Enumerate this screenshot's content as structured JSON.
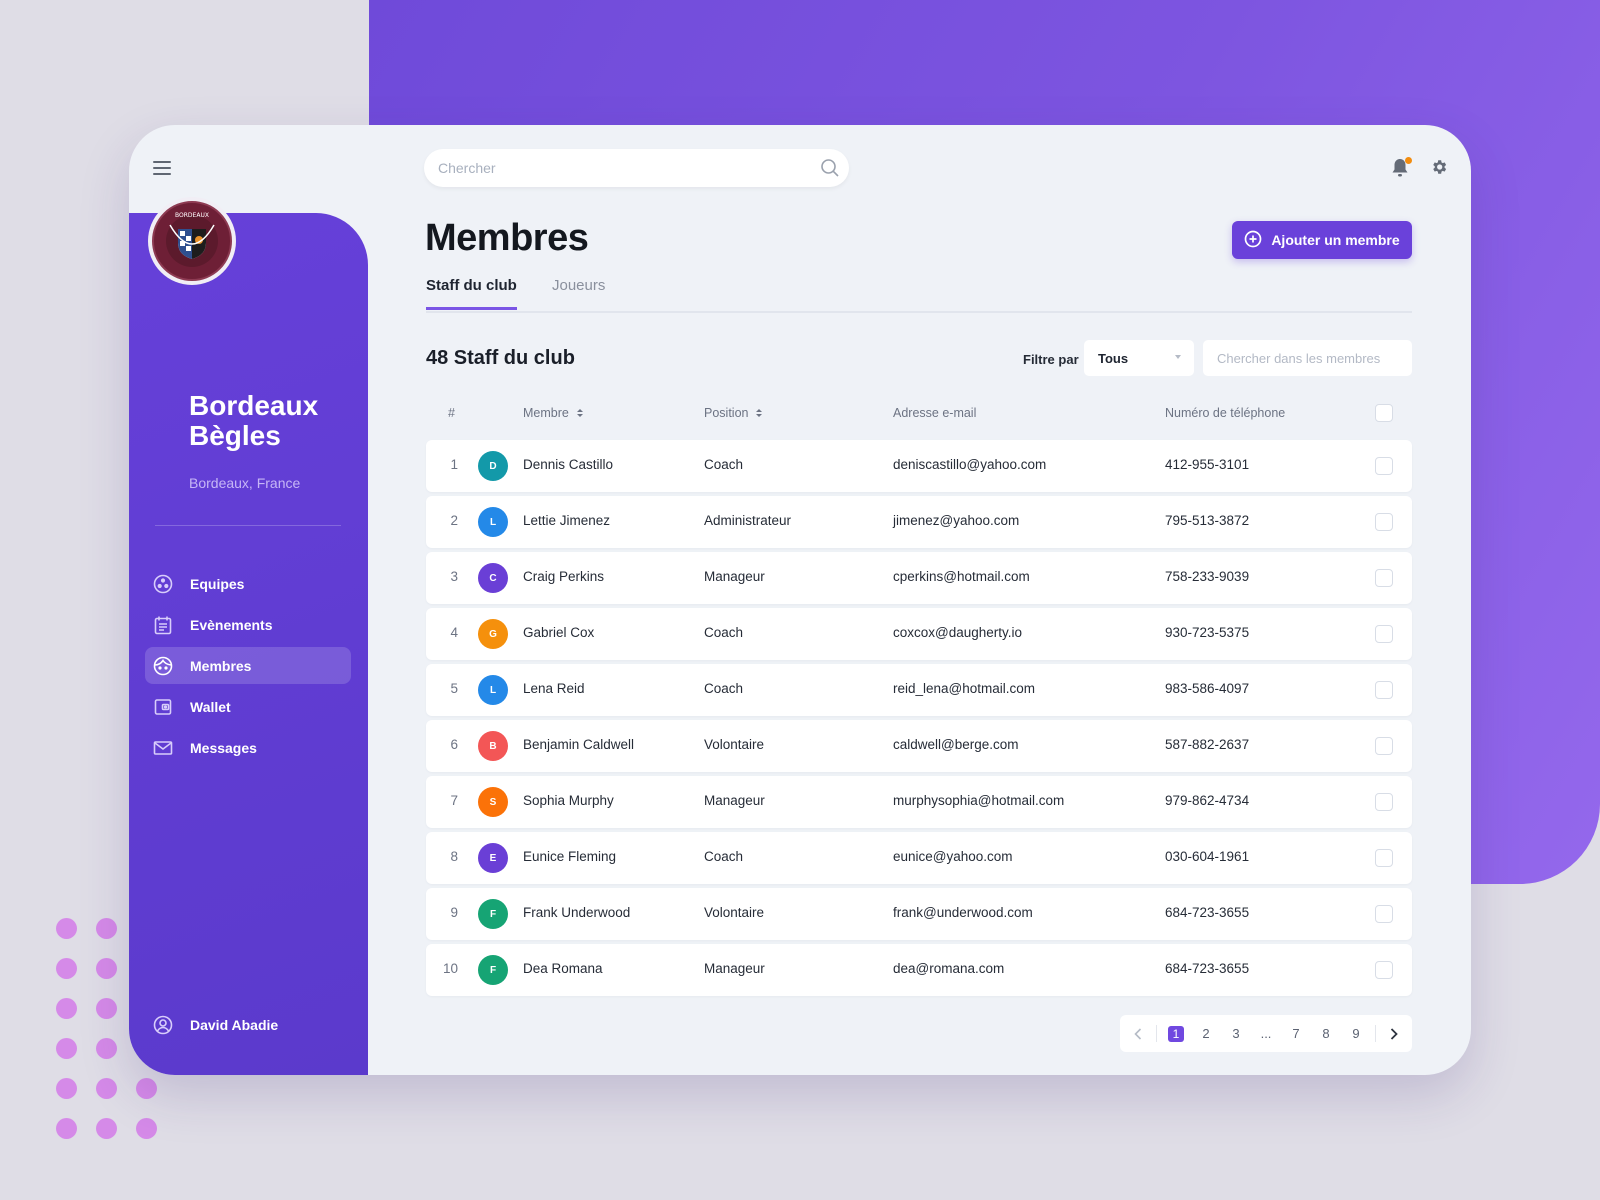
{
  "app": {
    "club_name": "Bordeaux Bègles",
    "club_location": "Bordeaux, France",
    "accent_color": "#6a41da",
    "notification_dot_color": "#f28c0f"
  },
  "topbar": {
    "search_placeholder": "Chercher",
    "icons": [
      "menu-icon",
      "search-icon",
      "bell-icon",
      "gear-icon"
    ]
  },
  "sidebar": {
    "items": [
      {
        "label": "Equipes",
        "icon": "teams-icon",
        "active": false
      },
      {
        "label": "Evènements",
        "icon": "calendar-icon",
        "active": false
      },
      {
        "label": "Membres",
        "icon": "face-icon",
        "active": true
      },
      {
        "label": "Wallet",
        "icon": "wallet-icon",
        "active": false
      },
      {
        "label": "Messages",
        "icon": "mail-icon",
        "active": false
      }
    ],
    "user": {
      "name": "David Abadie",
      "icon": "user-circle-icon"
    }
  },
  "main": {
    "title": "Membres",
    "add_button": "Ajouter un membre",
    "tabs": [
      {
        "label": "Staff du club",
        "active": true
      },
      {
        "label": "Joueurs",
        "active": false
      }
    ],
    "count_title": "48 Staff du club",
    "filter_label": "Filtre par",
    "filter_value": "Tous",
    "member_search_placeholder": "Chercher dans les membres",
    "columns": [
      "#",
      "Membre",
      "Position",
      "Adresse e-mail",
      "Numéro de téléphone"
    ],
    "rows": [
      {
        "idx": "1",
        "initial": "D",
        "color": "#1399a9",
        "name": "Dennis Castillo",
        "position": "Coach",
        "email": "deniscastillo@yahoo.com",
        "phone": "412-955-3101"
      },
      {
        "idx": "2",
        "initial": "L",
        "color": "#2489e8",
        "name": "Lettie Jimenez",
        "position": "Administrateur",
        "email": "jimenez@yahoo.com",
        "phone": "795-513-3872"
      },
      {
        "idx": "3",
        "initial": "C",
        "color": "#6a3fd6",
        "name": "Craig Perkins",
        "position": "Manageur",
        "email": "cperkins@hotmail.com",
        "phone": "758-233-9039"
      },
      {
        "idx": "4",
        "initial": "G",
        "color": "#f5900c",
        "name": "Gabriel Cox",
        "position": "Coach",
        "email": "coxcox@daugherty.io",
        "phone": "930-723-5375"
      },
      {
        "idx": "5",
        "initial": "L",
        "color": "#2489e8",
        "name": "Lena Reid",
        "position": "Coach",
        "email": "reid_lena@hotmail.com",
        "phone": "983-586-4097"
      },
      {
        "idx": "6",
        "initial": "B",
        "color": "#f35656",
        "name": "Benjamin Caldwell",
        "position": "Volontaire",
        "email": "caldwell@berge.com",
        "phone": "587-882-2637"
      },
      {
        "idx": "7",
        "initial": "S",
        "color": "#fb7208",
        "name": "Sophia Murphy",
        "position": "Manageur",
        "email": "murphysophia@hotmail.com",
        "phone": "979-862-4734"
      },
      {
        "idx": "8",
        "initial": "E",
        "color": "#6a3fd6",
        "name": "Eunice Fleming",
        "position": "Coach",
        "email": "eunice@yahoo.com",
        "phone": "030-604-1961"
      },
      {
        "idx": "9",
        "initial": "F",
        "color": "#16a474",
        "name": "Frank Underwood",
        "position": "Volontaire",
        "email": "frank@underwood.com",
        "phone": "684-723-3655"
      },
      {
        "idx": "10",
        "initial": "F",
        "color": "#16a474",
        "name": "Dea Romana",
        "position": "Manageur",
        "email": "dea@romana.com",
        "phone": "684-723-3655"
      }
    ],
    "pagination": {
      "pages": [
        "1",
        "2",
        "3",
        "...",
        "7",
        "8",
        "9"
      ],
      "current": "1"
    }
  }
}
